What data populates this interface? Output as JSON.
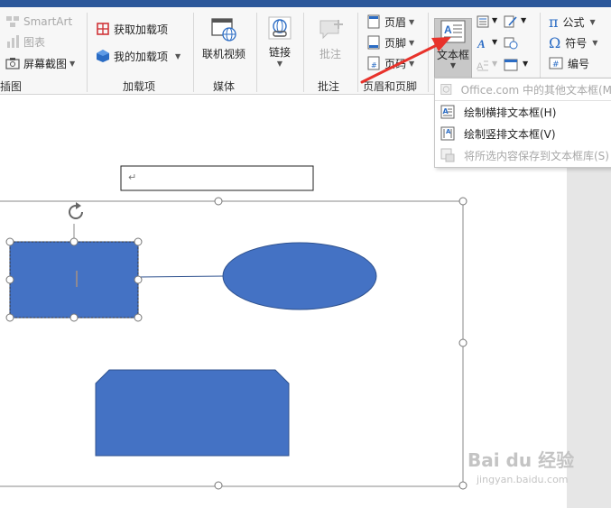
{
  "ribbon": {
    "groups": {
      "illustrations": {
        "label": "插图",
        "smartart_label": "SmartArt",
        "chart_label": "图表",
        "screenshot_label": "屏幕截图"
      },
      "addins": {
        "label": "加载项",
        "get_addins_label": "获取加载项",
        "my_addins_label": "我的加载项"
      },
      "media": {
        "label": "媒体",
        "online_video_label": "联机视频"
      },
      "links": {
        "link_label": "链接"
      },
      "comments": {
        "label": "批注",
        "comment_label": "批注"
      },
      "header_footer": {
        "label": "页眉和页脚",
        "header_label": "页眉",
        "footer_label": "页脚",
        "page_number_label": "页码"
      },
      "text": {
        "textbox_label": "文本框"
      },
      "symbols": {
        "equation_label": "公式",
        "symbol_label": "符号",
        "number_label": "编号"
      }
    }
  },
  "textbox_menu": {
    "items": [
      {
        "label": "Office.com 中的其他文本框(M",
        "enabled": false
      },
      {
        "label": "绘制横排文本框(H)",
        "enabled": true
      },
      {
        "label": "绘制竖排文本框(V)",
        "enabled": true
      },
      {
        "label": "将所选内容保存到文本框库(S)",
        "enabled": false
      }
    ]
  },
  "document": {
    "paragraph_mark": "↵"
  },
  "watermark": {
    "brand": "Bai du 经验",
    "url": "jingyan.baidu.com"
  },
  "colors": {
    "shape_fill": "#4472c4",
    "shape_stroke": "#2f528f",
    "arrow": "#e8322b",
    "ribbon_bg": "#f7f7f7",
    "title_bar": "#2b579a"
  }
}
